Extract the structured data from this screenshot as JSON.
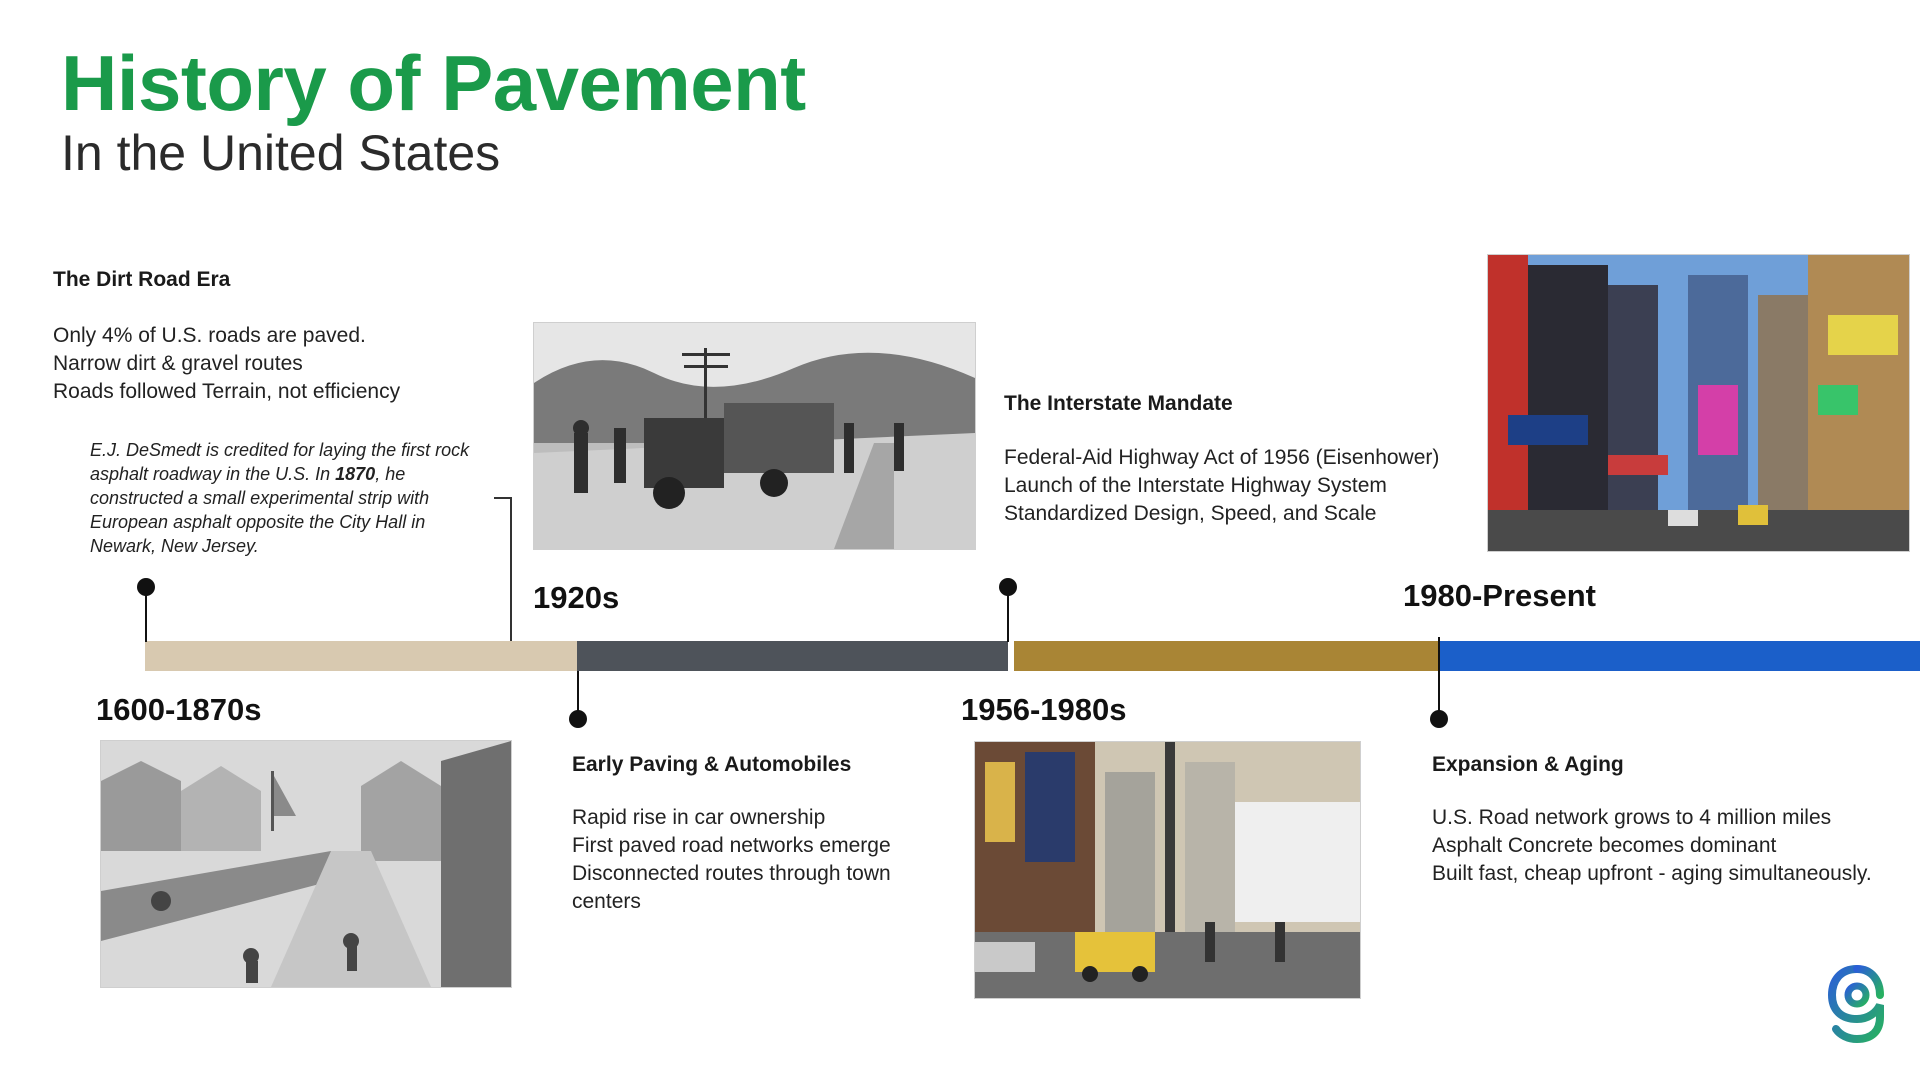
{
  "header": {
    "title": "History of Pavement",
    "subtitle": "In the United States"
  },
  "timeline": {
    "colors": {
      "era1": "#d8c9b0",
      "era2": "#4e535a",
      "era3": "#a98535",
      "era4": "#1b5fc9",
      "title_green": "#1a9a4a"
    },
    "labels": {
      "era1": "1600-1870s",
      "era2": "1920s",
      "era3": "1956-1980s",
      "era4": "1980-Present"
    }
  },
  "dirt_road": {
    "heading": "The Dirt Road Era",
    "lines": [
      "Only 4% of U.S. roads are paved.",
      "Narrow dirt & gravel routes",
      "Roads followed Terrain, not efficiency"
    ],
    "note_before": "E.J. DeSmedt is credited for laying the first rock asphalt roadway in the U.S. In ",
    "note_bold": "1870",
    "note_after": ", he constructed a small experimental strip with European asphalt opposite the City Hall in Newark, New Jersey."
  },
  "early_paving": {
    "heading": "Early Paving & Automobiles",
    "lines": [
      "Rapid rise in car ownership",
      "First paved road networks emerge",
      "Disconnected routes through town centers"
    ]
  },
  "interstate": {
    "heading": "The Interstate Mandate",
    "lines": [
      "Federal-Aid Highway Act of 1956 (Eisenhower)",
      "Launch of the Interstate Highway System",
      "Standardized Design, Speed, and Scale"
    ]
  },
  "expansion": {
    "heading": "Expansion & Aging",
    "lines": [
      "U.S. Road network grows to 4 million miles",
      "Asphalt Concrete becomes dominant",
      "Built fast, cheap upfront - aging simultaneously."
    ]
  }
}
